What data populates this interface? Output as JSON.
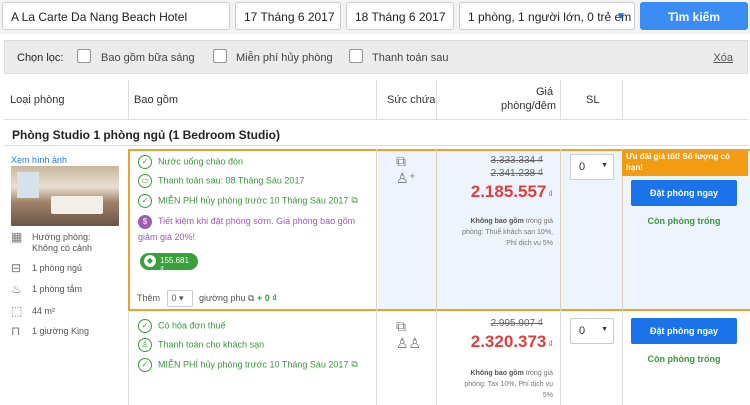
{
  "search": {
    "hotel": "A La Carte Da Nang Beach Hotel",
    "checkin": "17 Tháng 6 2017",
    "checkout": "18 Tháng 6 2017",
    "guests": "1 phòng, 1 người lớn, 0 trẻ em",
    "button": "Tìm kiếm"
  },
  "filter": {
    "label": "Chọn lọc:",
    "options": [
      "Bao gồm bữa sáng",
      "Miễn phí hủy phòng",
      "Thanh toán sau"
    ],
    "clear": "Xóa"
  },
  "table_header": {
    "room_type": "Loại phòng",
    "includes": "Bao gồm",
    "capacity": "Sức chứa",
    "price_line1": "Giá",
    "price_line2": "phòng/đêm",
    "qty": "SL"
  },
  "room": {
    "title": "Phòng Studio 1 phòng ngủ (1 Bedroom Studio)",
    "photo_link": "Xem hình ảnh",
    "amenities": [
      "Hướng phòng: Không có cảnh",
      "1 phòng ngủ",
      "1 phòng tắm",
      "44 m²",
      "1 giường King"
    ]
  },
  "offers": [
    {
      "includes": [
        "Nước uống chào đón",
        "Thanh toán sau: 08 Tháng Sáu 2017",
        "MIỄN PHÍ hủy phòng trước 10 Tháng Sáu 2017"
      ],
      "promo_text": "Tiết kiệm khi đặt phòng sớm. Giá phòng bao gồm giảm giá 20%!",
      "cashback": "155.681 ₫",
      "extra_label": "Thêm",
      "extra_qty": "0",
      "extra_bed": "giường phụ",
      "extra_price": "+ 0 ₫",
      "price_old1": "3.333.334 ₫",
      "price_old2": "2.341.238 ₫",
      "price": "2.185.557",
      "currency": "₫",
      "note_bold": "Không bao gồm",
      "note_rest": " trong giá phòng: Thuế khách sạn 10%, Phí dịch vụ 5%",
      "qty": "0",
      "badge": "Ưu đãi giá tốt! Số lượng có hạn!",
      "book": "Đặt phòng ngay",
      "availability": "Còn phòng trống"
    },
    {
      "includes": [
        "Có hóa đơn thuế",
        "Thanh toán cho khách sạn",
        "MIỄN PHÍ hủy phòng trước 10 Tháng Sáu 2017"
      ],
      "price_old1": "2.995.907 ₫",
      "price": "2.320.373",
      "currency": "₫",
      "note_bold": "Không bao gồm",
      "note_rest": " trong giá phòng: Tax 10%, Phí dịch vụ 5%",
      "qty": "0",
      "book": "Đặt phòng ngay",
      "availability": "Còn phòng trống"
    }
  ],
  "colors": {
    "accent": "#1a73e8",
    "price": "#e03e3e",
    "highlight": "#f39c12",
    "green": "#3a9a3a"
  }
}
